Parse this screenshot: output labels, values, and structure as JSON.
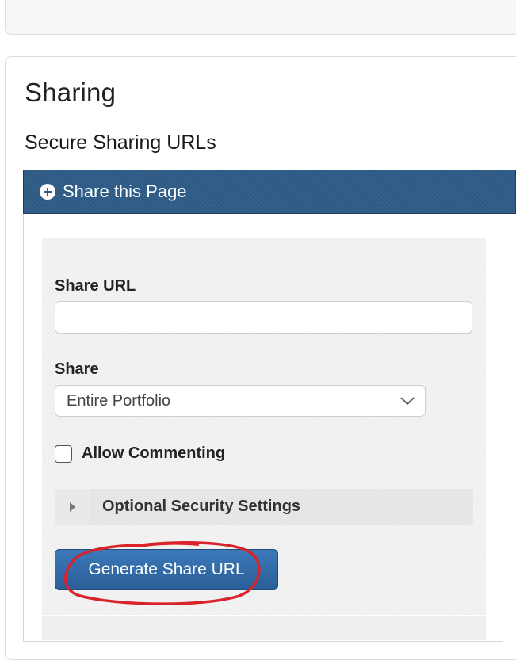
{
  "page": {
    "title": "Sharing",
    "subtitle": "Secure Sharing URLs"
  },
  "accordion": {
    "label": "Share this Page",
    "icon": "plus-circle-icon",
    "color": "#2d5a85"
  },
  "form": {
    "share_url": {
      "label": "Share URL",
      "value": "",
      "placeholder": ""
    },
    "share": {
      "label": "Share",
      "selected": "Entire Portfolio"
    },
    "allow_commenting": {
      "label": "Allow Commenting",
      "checked": false
    },
    "optional_security": {
      "label": "Optional Security Settings"
    },
    "generate_button": {
      "label": "Generate Share URL",
      "color": "#2f6aa8"
    }
  },
  "annotation": {
    "color": "#d8232a",
    "shape": "hand-drawn-circle"
  }
}
